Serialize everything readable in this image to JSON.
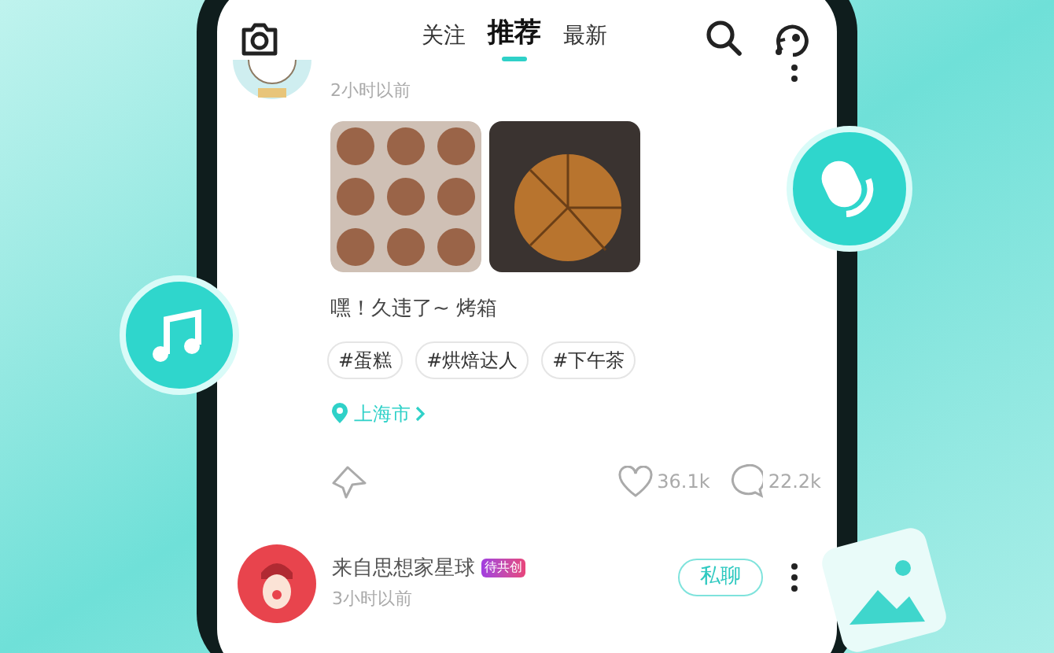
{
  "tabs": [
    {
      "label": "关注",
      "selected": false
    },
    {
      "label": "推荐",
      "selected": true
    },
    {
      "label": "最新",
      "selected": false
    }
  ],
  "post": {
    "time": "2小时以前",
    "caption": "嘿！久违了~ 烤箱",
    "tags": [
      "#蛋糕",
      "#烘焙达人",
      "#下午茶"
    ],
    "location": "上海市",
    "likes": "36.1k",
    "comments": "22.2k"
  },
  "next_post": {
    "author": "来自思想家星球",
    "badge": "待共创",
    "time": "3小时以前",
    "chat_button": "私聊"
  }
}
